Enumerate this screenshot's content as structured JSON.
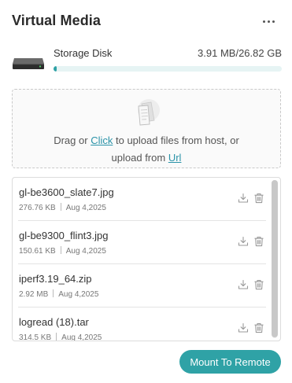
{
  "header": {
    "title": "Virtual Media",
    "more_icon": "more-horizontal-icon"
  },
  "disk": {
    "name": "Storage Disk",
    "usage": "3.91 MB/26.82 GB",
    "used_fraction": 0.0146,
    "icon": "hard-drive-icon",
    "bar_color": "#2fa2a6"
  },
  "dropzone": {
    "icon": "document-upload-icon",
    "text_before": "Drag or",
    "click_link": "Click",
    "text_middle": "to upload files from host, or",
    "text_before_url": "upload from",
    "url_link": "Url"
  },
  "files": [
    {
      "name": "gl-be3600_slate7.jpg",
      "size": "276.76 KB",
      "date": "Aug 4,2025"
    },
    {
      "name": "gl-be9300_flint3.jpg",
      "size": "150.61 KB",
      "date": "Aug 4,2025"
    },
    {
      "name": "iperf3.19_64.zip",
      "size": "2.92 MB",
      "date": "Aug 4,2025"
    },
    {
      "name": "logread (18).tar",
      "size": "314.5 KB",
      "date": "Aug 4,2025"
    }
  ],
  "actions": {
    "download_icon": "download-icon",
    "delete_icon": "trash-icon"
  },
  "mount_button": {
    "label": "Mount To Remote"
  },
  "colors": {
    "accent": "#2fa2a6",
    "link": "#2a93a8"
  }
}
